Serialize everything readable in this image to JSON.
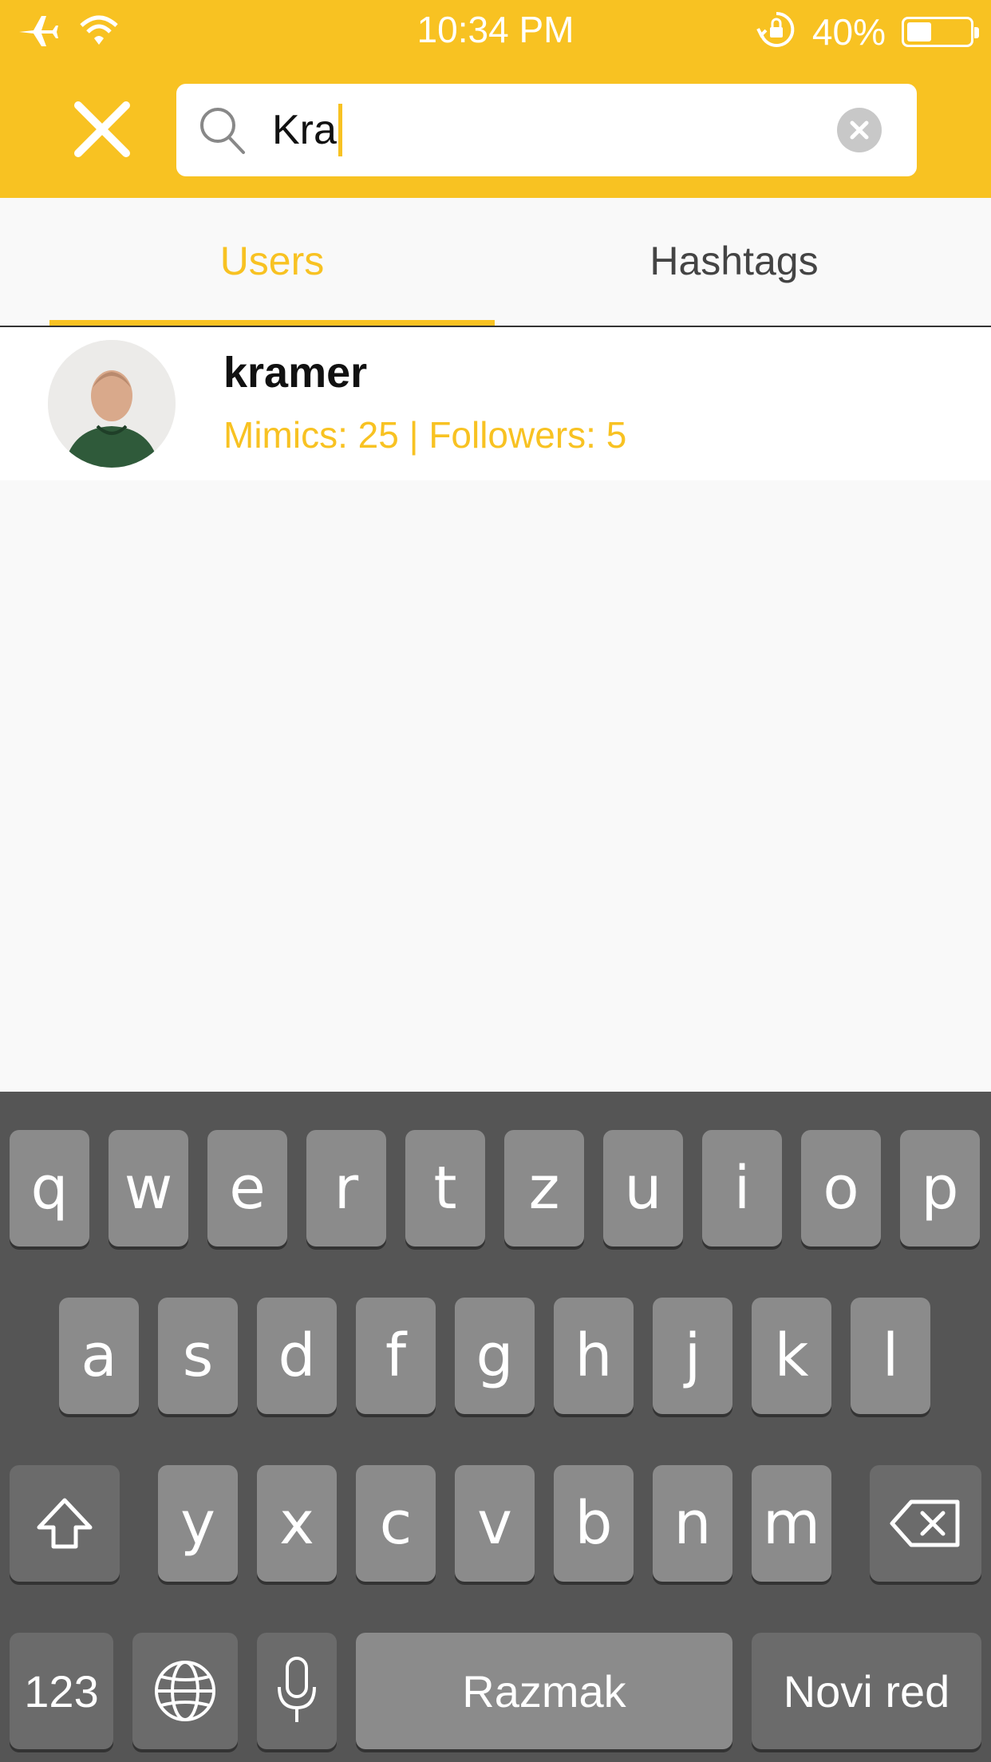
{
  "status_bar": {
    "time": "10:34 PM",
    "battery_percent": "40%",
    "battery_level": 0.4,
    "icons": [
      "airplane-icon",
      "wifi-icon",
      "rotation-lock-icon",
      "battery-icon"
    ]
  },
  "header": {
    "search_query": "Kra",
    "close_icon": "close-icon",
    "search_icon": "search-icon",
    "clear_icon": "clear-icon",
    "accent_color": "#f8c222"
  },
  "tabs": [
    {
      "label": "Users",
      "selected": true
    },
    {
      "label": "Hashtags",
      "selected": false
    }
  ],
  "results": [
    {
      "username": "kramer",
      "stats": "Mimics: 25 | Followers: 5"
    }
  ],
  "keyboard": {
    "row1": [
      "q",
      "w",
      "e",
      "r",
      "t",
      "z",
      "u",
      "i",
      "o",
      "p"
    ],
    "row2": [
      "a",
      "s",
      "d",
      "f",
      "g",
      "h",
      "j",
      "k",
      "l"
    ],
    "row3": [
      "y",
      "x",
      "c",
      "v",
      "b",
      "n",
      "m"
    ],
    "numbers_label": "123",
    "space_label": "Razmak",
    "return_label": "Novi red",
    "icons": [
      "shift-icon",
      "backspace-icon",
      "globe-icon",
      "microphone-icon"
    ]
  }
}
